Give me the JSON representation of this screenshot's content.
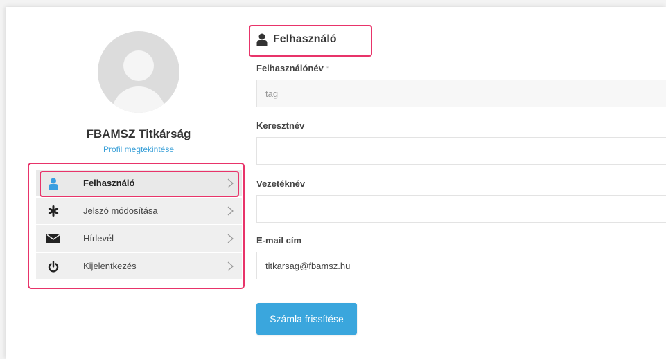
{
  "profile": {
    "name": "FBAMSZ Titkárság",
    "view_link": "Profil megtekintése"
  },
  "nav": {
    "items": [
      {
        "label": "Felhasználó",
        "icon": "user-icon",
        "active": true
      },
      {
        "label": "Jelszó módosítása",
        "icon": "asterisk-icon",
        "active": false
      },
      {
        "label": "Hírlevél",
        "icon": "envelope-icon",
        "active": false
      },
      {
        "label": "Kijelentkezés",
        "icon": "power-icon",
        "active": false
      }
    ]
  },
  "form": {
    "title": "Felhasználó",
    "username": {
      "label": "Felhasználónév",
      "required_mark": "*",
      "value": "tag"
    },
    "firstname": {
      "label": "Keresztnév",
      "value": ""
    },
    "lastname": {
      "label": "Vezetéknév",
      "value": ""
    },
    "email": {
      "label": "E-mail cím",
      "value": "titkarsag@fbamsz.hu"
    },
    "submit_label": "Számla frissítése"
  },
  "colors": {
    "accent": "#3aa6dd",
    "highlight": "#e8346a",
    "active_icon": "#3a9ee0"
  }
}
